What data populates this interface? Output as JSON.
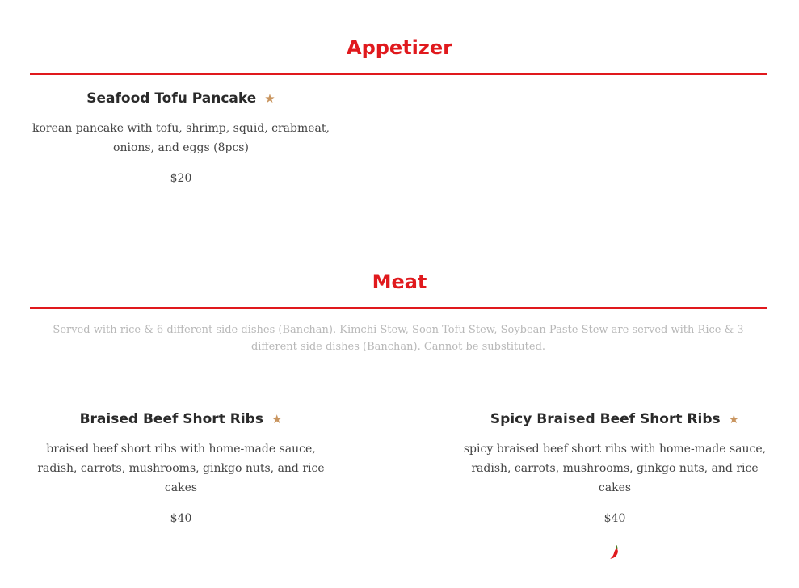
{
  "sections": {
    "appetizer": {
      "title": "Appetizer",
      "items": [
        {
          "name": "Seafood Tofu Pancake",
          "description": "korean pancake with tofu, shrimp, squid, crabmeat, onions, and eggs (8pcs)",
          "price": "$20",
          "featured_icon": "star-icon"
        }
      ]
    },
    "meat": {
      "title": "Meat",
      "note": "Served with rice & 6 different side dishes (Banchan). Kimchi Stew, Soon Tofu Stew, Soybean Paste Stew are served with Rice & 3 different side dishes (Banchan). Cannot be substituted.",
      "items": [
        {
          "name": "Braised Beef Short Ribs",
          "description": "braised beef short ribs with home-made sauce, radish, carrots, mushrooms, ginkgo nuts, and rice cakes",
          "price": "$40",
          "featured_icon": "star-icon"
        },
        {
          "name": "Spicy Braised Beef Short Ribs",
          "description": "spicy braised beef short ribs with home-made sauce, radish, carrots, mushrooms, ginkgo nuts, and rice cakes",
          "price": "$40",
          "featured_icon": "star-icon",
          "spicy_icon": "chili-pepper-icon"
        }
      ]
    }
  },
  "symbols": {
    "star": "★"
  },
  "colors": {
    "accent": "#e0191d",
    "star": "#c9955f",
    "note": "#b8b8b8"
  }
}
